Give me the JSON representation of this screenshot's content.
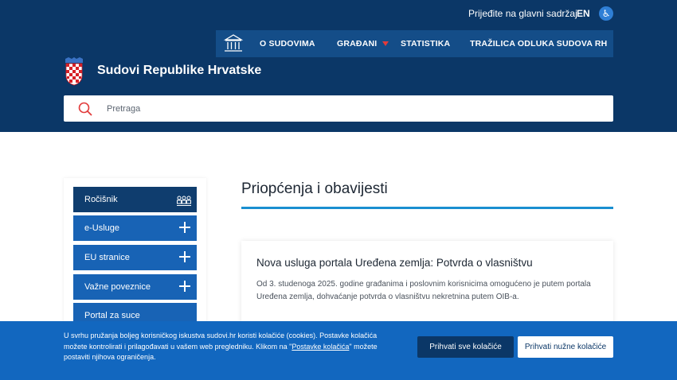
{
  "topbar": {
    "skip_link": "Prijeđite na glavni sadržaj",
    "lang": "EN",
    "accessibility_icon": "accessibility-icon"
  },
  "nav": {
    "home_icon": "courthouse-icon",
    "items": [
      {
        "label": "O SUDOVIMA"
      },
      {
        "label": "GRAĐANI",
        "has_dropdown": true
      },
      {
        "label": "STATISTIKA"
      },
      {
        "label": "TRAŽILICA ODLUKA SUDOVA RH"
      }
    ]
  },
  "brand": {
    "title": "Sudovi Republike Hrvatske",
    "logo_icon": "croatian-coat-of-arms-icon"
  },
  "search": {
    "placeholder": "Pretraga",
    "icon": "search-icon"
  },
  "sidebar": {
    "items": [
      {
        "label": "Ročišnik",
        "icon": "people-group-icon",
        "active": true
      },
      {
        "label": "e-Usluge",
        "icon": "plus-icon"
      },
      {
        "label": "EU stranice",
        "icon": "plus-icon"
      },
      {
        "label": "Važne poveznice",
        "icon": "plus-icon"
      },
      {
        "label": "Portal za suce"
      }
    ]
  },
  "main": {
    "title": "Priopćenja i obavijesti",
    "cards": [
      {
        "title": "Nova usluga portala Uređena zemlja: Potvrda o vlasništvu",
        "text": "Od 3. studenoga 2025. godine građanima i poslovnim korisnicima omogućeno je putem portala Uređena zemlja, dohvaćanje potvrda o vlasništvu nekretnina putem OIB-a."
      }
    ]
  },
  "cookie": {
    "text_before": "U svrhu pružanja boljeg korisničkog iskustva sudovi.hr koristi kolačiće (cookies). Postavke kolačića možete kontrolirati i prilagođavati u vašem web pregledniku. Klikom na \"",
    "link": "Postavke kolačića",
    "text_after": "\" možete postaviti njihova ograničenja.",
    "accept_all": "Prihvati sve kolačiće",
    "accept_necessary": "Prihvati nužne kolačiće"
  },
  "colors": {
    "header_bg": "#0b3767",
    "nav_bg": "#144d88",
    "sidebar_item": "#1863b5",
    "sidebar_active": "#0f3d6e",
    "accent_rule": "#1a8fd0",
    "cookie_bg": "#1267bf",
    "search_icon": "#e23b3b"
  }
}
